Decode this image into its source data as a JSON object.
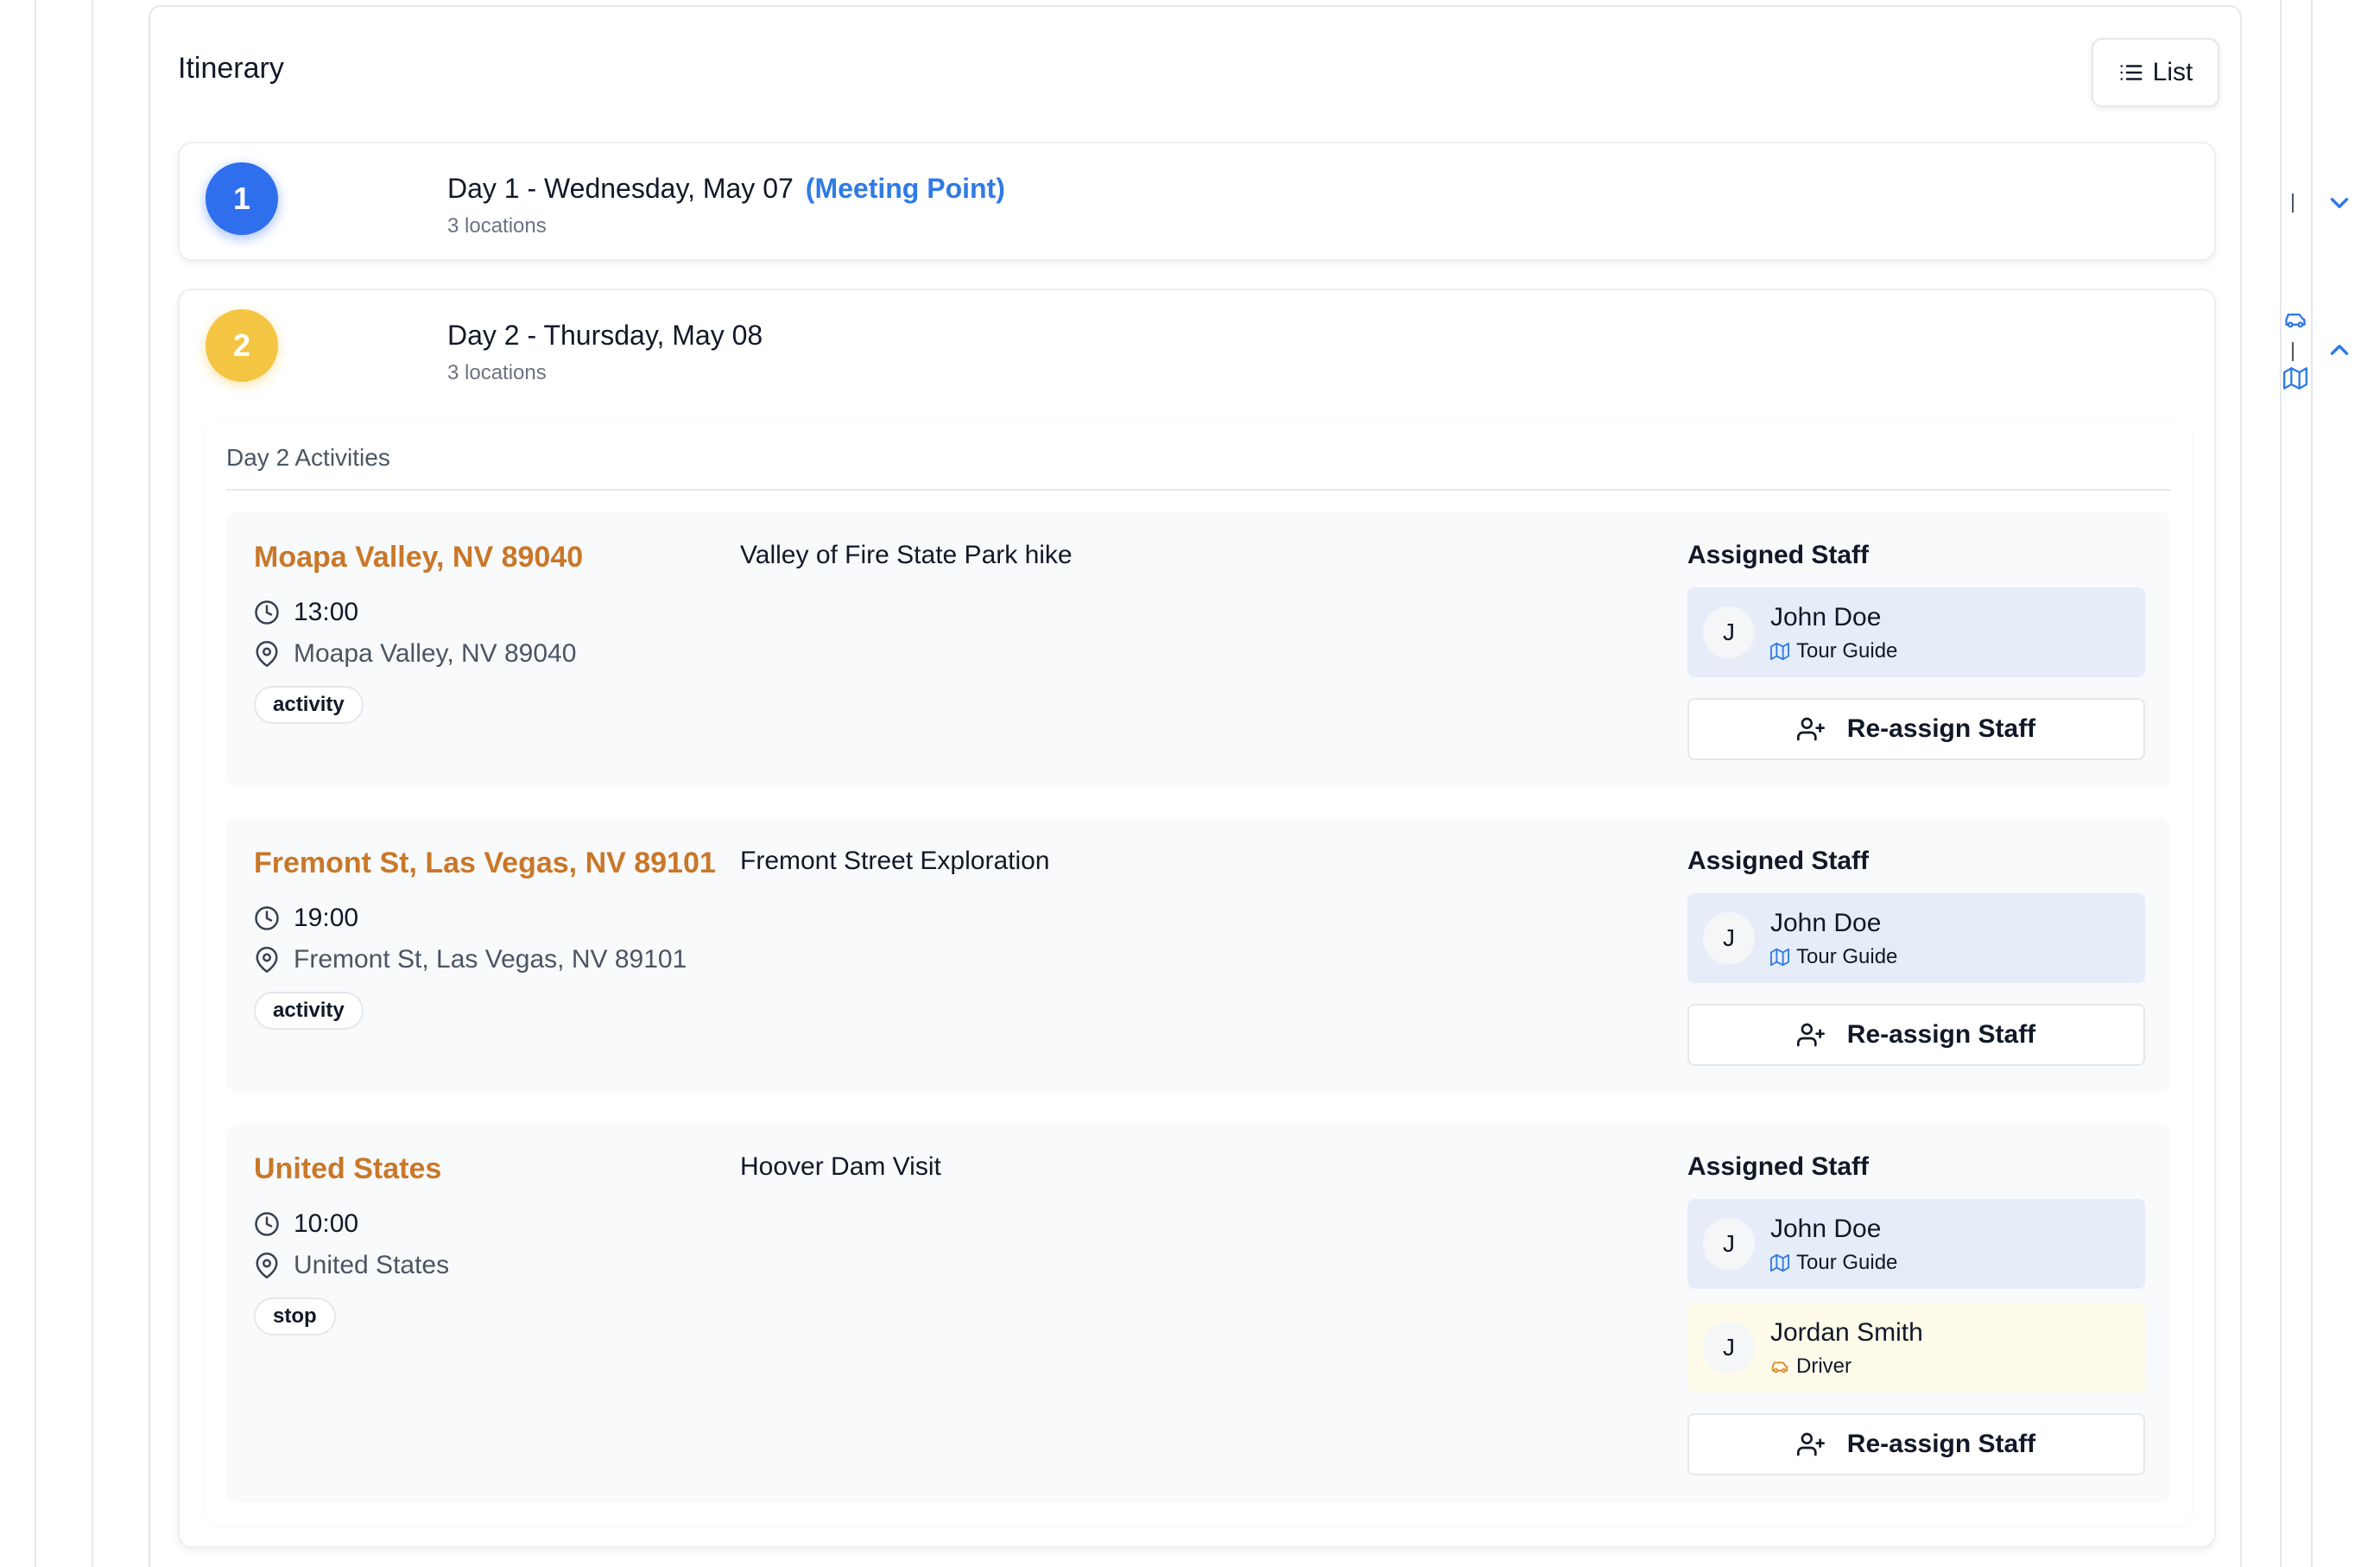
{
  "card": {
    "title": "Itinerary",
    "view_toggle_label": "List"
  },
  "days": [
    {
      "number": "1",
      "title": "Day 1 - Wednesday, May 07",
      "tag": "(Meeting Point)",
      "subtitle": "3 locations",
      "expanded": false,
      "badge_color": "#2f6fed"
    },
    {
      "number": "2",
      "title": "Day 2 - Thursday, May 08",
      "subtitle": "3 locations",
      "expanded": true,
      "badge_color": "#f4c542",
      "activities_heading": "Day 2 Activities",
      "activities": [
        {
          "location": "Moapa Valley, NV 89040",
          "time": "13:00",
          "address": "Moapa Valley, NV 89040",
          "type": "activity",
          "description": "Valley of Fire State Park hike",
          "staff_heading": "Assigned Staff",
          "staff": [
            {
              "initial": "J",
              "name": "John Doe",
              "role": "Tour Guide",
              "role_icon": "map-icon"
            }
          ],
          "reassign_label": "Re-assign Staff"
        },
        {
          "location": "Fremont St, Las Vegas, NV 89101",
          "time": "19:00",
          "address": "Fremont St, Las Vegas, NV 89101",
          "type": "activity",
          "description": "Fremont Street Exploration",
          "staff_heading": "Assigned Staff",
          "staff": [
            {
              "initial": "J",
              "name": "John Doe",
              "role": "Tour Guide",
              "role_icon": "map-icon"
            }
          ],
          "reassign_label": "Re-assign Staff"
        },
        {
          "location": "United States",
          "time": "10:00",
          "address": "United States",
          "type": "stop",
          "description": "Hoover Dam Visit",
          "staff_heading": "Assigned Staff",
          "staff": [
            {
              "initial": "J",
              "name": "John Doe",
              "role": "Tour Guide",
              "role_icon": "map-icon"
            },
            {
              "initial": "J",
              "name": "Jordan Smith",
              "role": "Driver",
              "role_icon": "car-icon"
            }
          ],
          "reassign_label": "Re-assign Staff"
        }
      ]
    }
  ],
  "colors": {
    "accent_blue": "#2f7ae5",
    "location_orange": "#c97729",
    "guide_bg": "#e6edf9",
    "driver_bg": "#fefbeb"
  }
}
